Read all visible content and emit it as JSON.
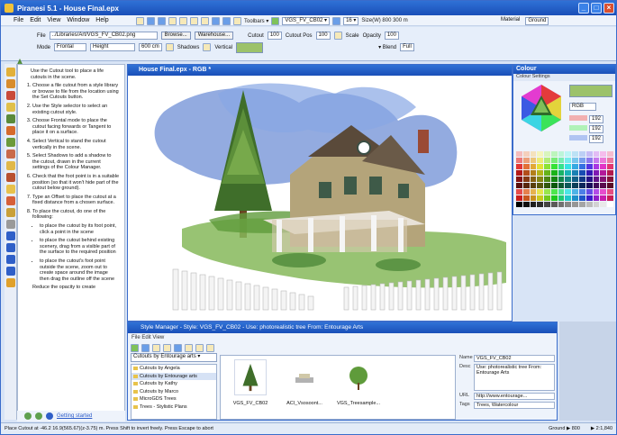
{
  "app": {
    "title": "Piranesi 5.1 - House Final.epx",
    "win_min": "_",
    "win_max": "□",
    "win_close": "×"
  },
  "menu": [
    "File",
    "Edit",
    "View",
    "Window",
    "Help"
  ],
  "toolbar": {
    "toolbars_label": "Toolbars ▾",
    "style_dd": "VGS_FV_CB02 ▾",
    "zoom_dd": "16 ▾",
    "size_readout": "Size(W) 800 300 m",
    "material_label": "Material",
    "material_value": "Ground"
  },
  "propbar": {
    "file_label": "File",
    "file_value": "../Libraries/Art/VGS_FV_CB02.png",
    "browse_btn": "Browse...",
    "warehouse_btn": "Warehouse...",
    "cutout_label": "Cutout",
    "cutout_value": "100",
    "cutout_pos_label": "Cutout Pos",
    "cutout_pos_value": "100",
    "scale_label": "Scale",
    "opacity_label": "Opacity",
    "opacity_value": "100",
    "mode_label": "Mode",
    "mode_value": "Frontal",
    "height_label": "Height",
    "height_value": "600 cm",
    "shadows_label": "Shadows",
    "verticals_label": "Vertical",
    "blend_label": "▾ Blend",
    "blend_value": "Full"
  },
  "help": {
    "intro": "Use the Cutout tool to place a life cutouts in the scene.",
    "steps": [
      "Choose a file cutout from a style library or browse to file from the location using the Set Cutouts button.",
      "Use the Style selector to select an existing cutout style.",
      "Choose Frontal mode to place the cutout facing forwards or Tangent to place it on a surface.",
      "Select Vertical to stand the cutout vertically in the scene.",
      "Select Shadows to add a shadow to the cutout, drawn in the current settings of the Colour Manager.",
      "Check that the foot point is in a suitable position (so that it won't hide part of the cutout below ground).",
      "Type an Offset to place the cutout at a fixed distance from a chosen surface.",
      "To place the cutout, do one of the following:"
    ],
    "bullets": [
      "to place the cutout by its foot point, click a point in the scene",
      "to place the cutout behind existing scenery, drag from a visible part of the surface to the required position",
      "to place the cutout's foot point outside the scene, zoom out to create space around the image then drag the outline off the scene"
    ],
    "last": "Reduce the opacity to create",
    "footer": "Getting started"
  },
  "doc": {
    "title": "House Final.epx - RGB *"
  },
  "colour": {
    "title": "Colour",
    "subtitle": "Colour Settings",
    "model": "RGB",
    "r": "192",
    "g": "192",
    "b": "192"
  },
  "style_manager": {
    "title": "Style Manager - Style: VGS_FV_CB02 - Use: photorealistic tree From: Entourage Arts",
    "menu": "File   Edit   View",
    "category_dd": "Cutouts by Entourage arts ▾",
    "categories": [
      "Cutouts by Angela",
      "Cutouts by Entourage arts",
      "Cutouts by Kathy",
      "Cutouts by Marco",
      "MicroGDS Trees",
      "Trees - Stylistic Plans"
    ],
    "thumbs": [
      "VGS_FV_CB02",
      "ACI_Vsosoont...",
      "VGS_Treesample..."
    ],
    "detail": {
      "name_label": "Name",
      "name_value": "VGS_FV_CB02",
      "desc_label": "Desc",
      "desc_value": "Use: photorealistic tree From: Entourage Arts",
      "url_label": "URL",
      "url_value": "http://www.entourage...",
      "tags_label": "Tags",
      "tags_value": "Trees, Watercolour"
    }
  },
  "status": {
    "left": "Place Cutout at -46.2 16.9(565.67)(z-3.75) m. Press Shift to invert freely. Press Escape to abort",
    "right1": "Ground ▶ 800",
    "right2": "▶ 2:1,840"
  },
  "colors": {
    "title_blue": "#1a4fb8",
    "accent_green": "#9cc26a",
    "app_bg": "#d8e4f6"
  }
}
